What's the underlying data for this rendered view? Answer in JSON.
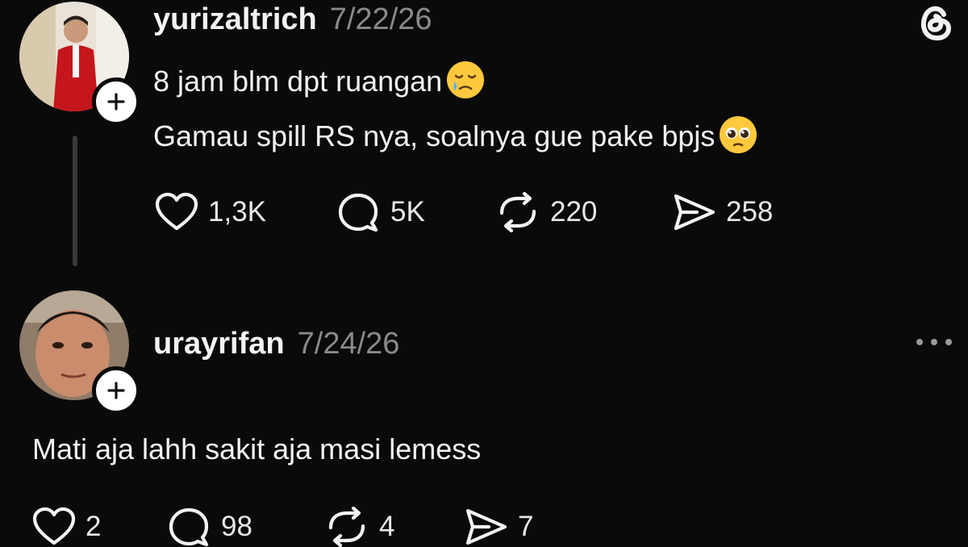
{
  "post": {
    "username": "yurizaltrich",
    "date": "7/22/26",
    "lines": [
      "8 jam blm dpt ruangan",
      "Gamau spill RS nya, soalnya gue pake bpjs"
    ],
    "emojis": [
      "crying-face-emoji",
      "pleading-face-emoji"
    ],
    "actions": {
      "likes": "1,3K",
      "replies": "5K",
      "reposts": "220",
      "shares": "258"
    }
  },
  "reply": {
    "username": "urayrifan",
    "date": "7/24/26",
    "text": "Mati aja lahh sakit aja masi lemess",
    "actions": {
      "likes": "2",
      "replies": "98",
      "reposts": "4",
      "shares": "7"
    }
  },
  "icons": {
    "app_logo": "threads-logo-icon",
    "more": "more-icon",
    "like": "heart-icon",
    "reply": "comment-icon",
    "repost": "repost-icon",
    "share": "share-icon",
    "follow": "plus-icon"
  },
  "colors": {
    "background": "#0a0a0a",
    "text": "#f3f3f3",
    "muted": "#8a8a8a",
    "thread_line": "#3a3a3a"
  }
}
